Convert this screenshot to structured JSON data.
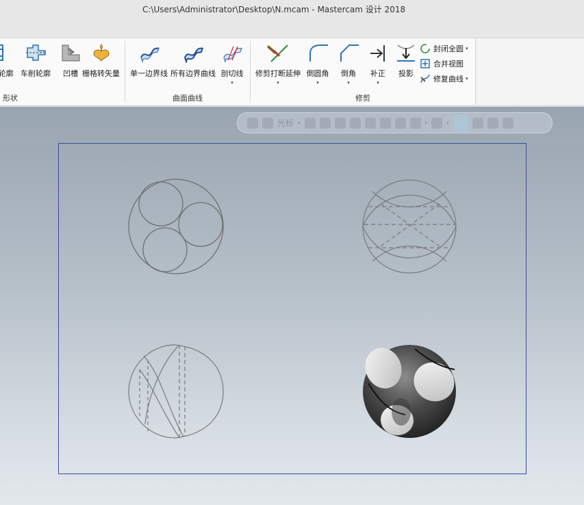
{
  "window": {
    "title": "C:\\Users\\Administrator\\Desktop\\N.mcam - Mastercam 设计 2018"
  },
  "ribbon": {
    "groups": [
      {
        "label": "形状"
      },
      {
        "label": "曲面曲线"
      },
      {
        "label": "修剪"
      }
    ],
    "shape_buttons": [
      {
        "label": "转轮廓",
        "icon": "turn-profile-icon"
      },
      {
        "label": "车削轮廓",
        "icon": "lathe-profile-icon"
      },
      {
        "label": "凹槽",
        "icon": "groove-icon"
      },
      {
        "label": "栅格转矢量",
        "icon": "raster-to-vector-icon"
      }
    ],
    "surface_curve_buttons": [
      {
        "label": "单一边界线",
        "icon": "single-edge-curve-icon"
      },
      {
        "label": "所有边界曲线",
        "icon": "all-edge-curves-icon"
      },
      {
        "label": "剖切线",
        "icon": "slice-curve-icon"
      }
    ],
    "trim_buttons": [
      {
        "label": "修剪打断延伸",
        "icon": "trim-break-extend-icon"
      },
      {
        "label": "倒圆角",
        "icon": "fillet-icon"
      },
      {
        "label": "倒角",
        "icon": "chamfer-icon"
      },
      {
        "label": "补正",
        "icon": "offset-icon"
      },
      {
        "label": "投影",
        "icon": "project-icon"
      }
    ],
    "trim_small_buttons": [
      {
        "label": "封闭全圆",
        "icon": "close-arc-icon"
      },
      {
        "label": "合并视图",
        "icon": "join-view-icon"
      },
      {
        "label": "修复曲线",
        "icon": "repair-curve-icon"
      }
    ]
  },
  "graphics": {
    "selection_toolbar": {
      "cursor_label": "光标"
    },
    "colors": {
      "sheet_border": "#3d4a9a",
      "wire": "#6f6f6f",
      "solid_dark": "#2e2e2e"
    }
  }
}
